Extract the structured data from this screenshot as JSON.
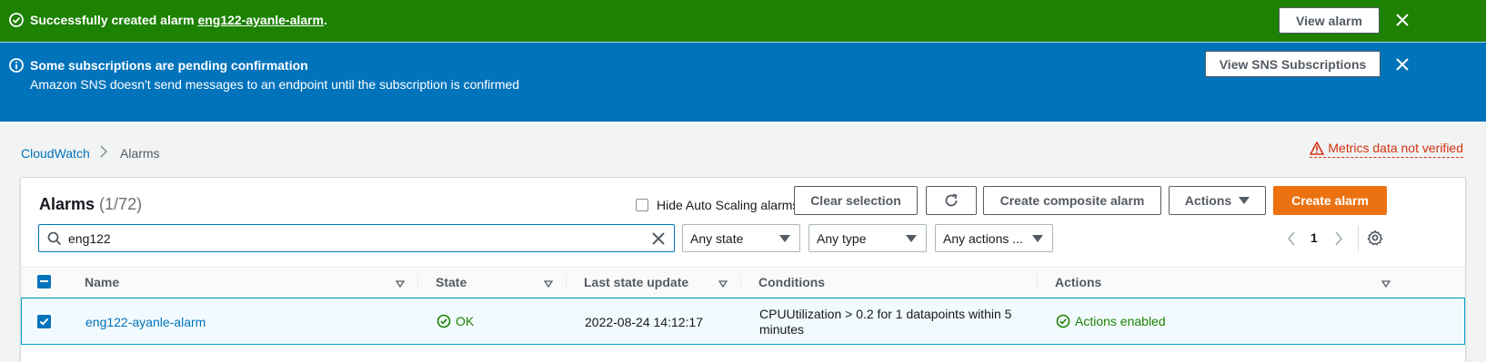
{
  "flash_success": {
    "text_prefix": "Successfully created alarm ",
    "alarm_link": "eng122-ayanle-alarm",
    "text_suffix": ".",
    "button": "View alarm"
  },
  "flash_info": {
    "title": "Some subscriptions are pending confirmation",
    "message": "Amazon SNS doesn't send messages to an endpoint until the subscription is confirmed",
    "button": "View SNS Subscriptions"
  },
  "breadcrumb": {
    "root": "CloudWatch",
    "current": "Alarms"
  },
  "metrics_warning": "Metrics data not verified",
  "alarms": {
    "title": "Alarms",
    "count": "(1/72)",
    "hide_auto_scaling": "Hide Auto Scaling alarms",
    "buttons": {
      "clear_selection": "Clear selection",
      "create_composite": "Create composite alarm",
      "actions": "Actions",
      "create_alarm": "Create alarm"
    },
    "search": {
      "value": "eng122"
    },
    "filters": {
      "state": "Any state",
      "type": "Any type",
      "actions": "Any actions ..."
    },
    "page": "1",
    "columns": {
      "name": "Name",
      "state": "State",
      "last_update": "Last state update",
      "conditions": "Conditions",
      "actions": "Actions"
    },
    "rows": [
      {
        "name": "eng122-ayanle-alarm",
        "state": "OK",
        "last_update": "2022-08-24 14:12:17",
        "conditions_line1": "CPUUtilization > 0.2 for 1 datapoints within 5",
        "conditions_line2": "minutes",
        "actions": "Actions enabled"
      }
    ]
  },
  "colors": {
    "success": "#1d8102",
    "info": "#0073bb",
    "primary_button": "#ec7211",
    "warning": "#d13212"
  }
}
